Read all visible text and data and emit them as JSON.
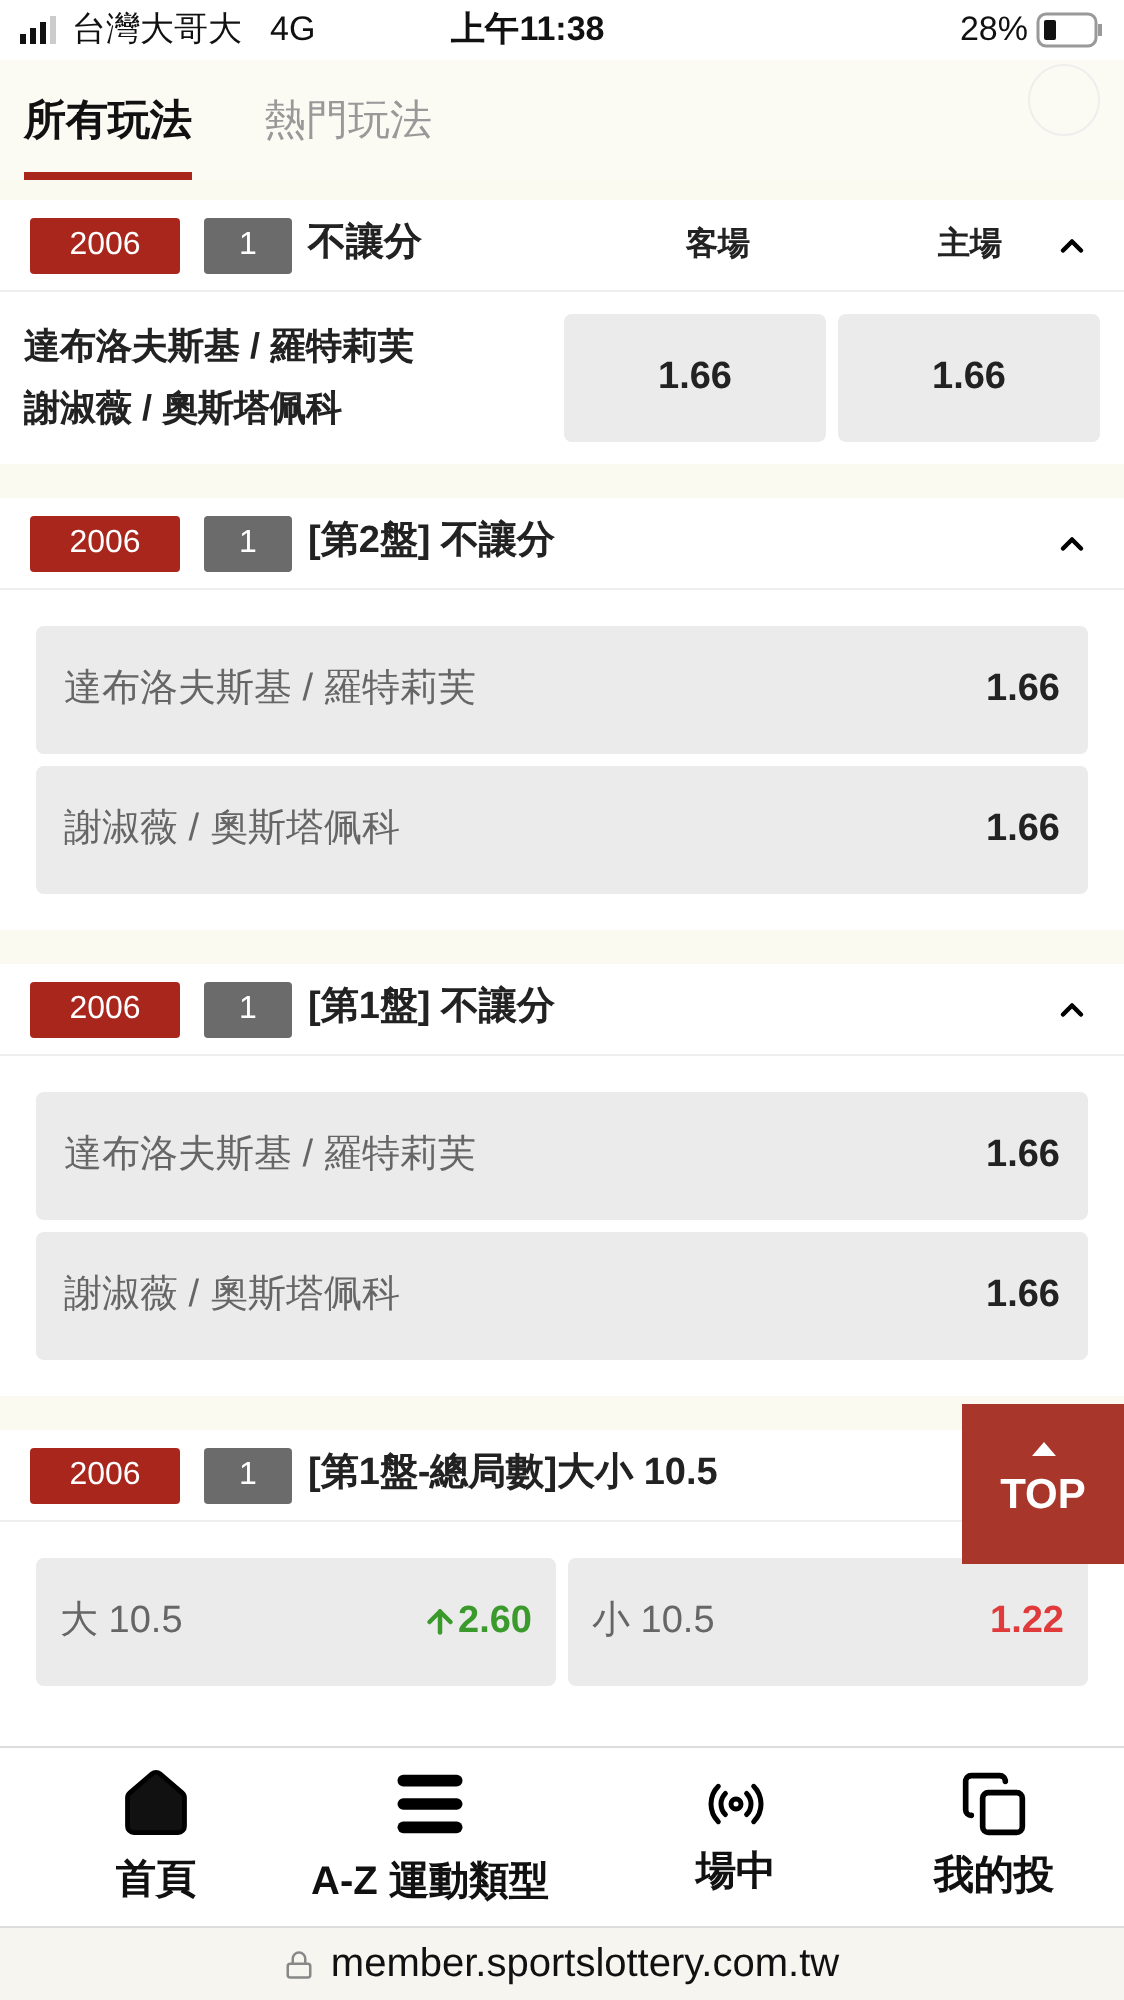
{
  "status_bar": {
    "carrier": "台灣大哥大",
    "network": "4G",
    "time": "上午11:38",
    "battery": "28%"
  },
  "tabs": [
    {
      "label": "所有玩法",
      "selected": true
    },
    {
      "label": "熱門玩法",
      "selected": false
    }
  ],
  "markets": [
    {
      "kind": "columns",
      "code": "2006",
      "number": "1",
      "title": "不讓分",
      "expanded": true,
      "column_headers": [
        "客場",
        "主場"
      ],
      "participants": [
        "達布洛夫斯基 / 羅特莉芙",
        "謝淑薇 / 奧斯塔佩科"
      ],
      "odds": [
        "1.66",
        "1.66"
      ]
    },
    {
      "kind": "list",
      "code": "2006",
      "number": "1",
      "title": "[第2盤] 不讓分",
      "expanded": true,
      "options": [
        {
          "label": "達布洛夫斯基 / 羅特莉芙",
          "odds": "1.66"
        },
        {
          "label": "謝淑薇 / 奧斯塔佩科",
          "odds": "1.66"
        }
      ]
    },
    {
      "kind": "list",
      "code": "2006",
      "number": "1",
      "title": "[第1盤] 不讓分",
      "expanded": true,
      "options": [
        {
          "label": "達布洛夫斯基 / 羅特莉芙",
          "odds": "1.66"
        },
        {
          "label": "謝淑薇 / 奧斯塔佩科",
          "odds": "1.66"
        }
      ]
    },
    {
      "kind": "split",
      "code": "2006",
      "number": "1",
      "title": "[第1盤-總局數]大小 10.5",
      "options": [
        {
          "label": "大 10.5",
          "odds": "2.60",
          "kind": "rising"
        },
        {
          "label": "小 10.5",
          "odds": "1.22",
          "kind": "falling"
        }
      ]
    }
  ],
  "top_button": "TOP",
  "bottom_nav": [
    {
      "label": "首頁"
    },
    {
      "label": "A-Z 運動類型"
    },
    {
      "label": "場中"
    },
    {
      "label": "我的投"
    }
  ],
  "url": "member.sportslottery.com.tw"
}
